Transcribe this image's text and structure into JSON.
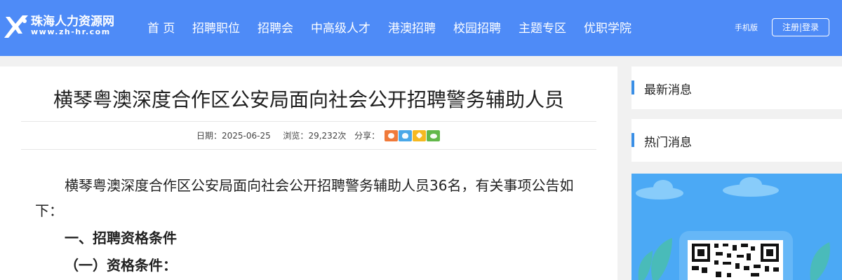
{
  "site": {
    "logo_cn": "珠海人力资源网",
    "logo_en": "www.zh-hr.com"
  },
  "nav": {
    "items": [
      {
        "label": "首 页"
      },
      {
        "label": "招聘职位"
      },
      {
        "label": "招聘会"
      },
      {
        "label": "中高级人才"
      },
      {
        "label": "港澳招聘"
      },
      {
        "label": "校园招聘"
      },
      {
        "label": "主题专区"
      },
      {
        "label": "优职学院"
      }
    ],
    "mobile_label": "手机版",
    "auth_label": "注册|登录"
  },
  "article": {
    "title": "横琴粤澳深度合作区公安局面向社会公开招聘警务辅助人员",
    "date_label": "日期：",
    "date": "2025-06-25",
    "views_label": "浏览：",
    "views": "29,232次",
    "share_label": "分享：",
    "intro": "横琴粤澳深度合作区公安局面向社会公开招聘警务辅助人员36名，有关事项公告如下：",
    "section1": "一、招聘资格条件",
    "section1_sub": "（一）资格条件："
  },
  "sidebar": {
    "latest_title": "最新消息",
    "hot_title": "热门消息"
  },
  "colors": {
    "header_bg": "#4e8bf7",
    "accent": "#3a8fe6",
    "share_weibo": "#f07a3a",
    "share_qq": "#4aa8e8",
    "share_qzone": "#f5b921",
    "share_wechat": "#62b84a"
  },
  "icons": {
    "logo": "running-person-logo-icon",
    "share": [
      "weibo-icon",
      "qq-icon",
      "qzone-star-icon",
      "wechat-icon"
    ],
    "qr": "qr-code-icon"
  }
}
